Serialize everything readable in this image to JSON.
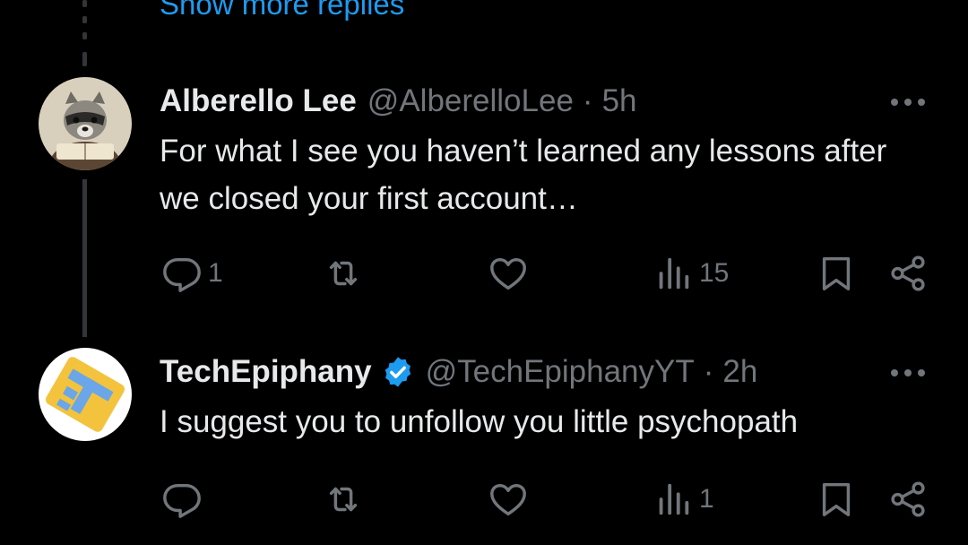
{
  "thread": {
    "show_more_label": "Show more replies"
  },
  "tweets": [
    {
      "name": "Alberello Lee",
      "handle": "@AlberelloLee",
      "separator": "·",
      "time": "5h",
      "verified": false,
      "text": "For what I see you haven’t learned any lessons after we closed your first account…",
      "counts": {
        "replies": "1",
        "reposts": "",
        "likes": "",
        "views": "15"
      }
    },
    {
      "name": "TechEpiphany",
      "handle": "@TechEpiphanyYT",
      "separator": "·",
      "time": "2h",
      "verified": true,
      "text": "I suggest you to unfollow you little psychopath",
      "counts": {
        "replies": "",
        "reposts": "",
        "likes": "",
        "views": "1"
      }
    }
  ],
  "icons": [
    "reply-icon",
    "repost-icon",
    "like-icon",
    "views-icon",
    "bookmark-icon",
    "share-icon",
    "more-icon",
    "verified-badge-icon"
  ],
  "colors": {
    "background": "#000000",
    "text": "#e7e9ea",
    "muted": "#71767b",
    "link": "#1d9bf0",
    "verified": "#1d9bf0",
    "thread_line": "#333639"
  }
}
